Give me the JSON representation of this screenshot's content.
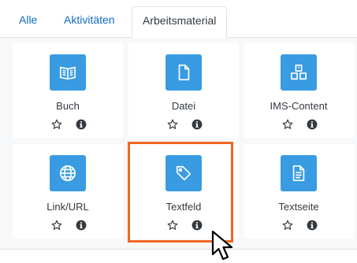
{
  "tabs": [
    {
      "label": "Alle",
      "active": false
    },
    {
      "label": "Aktivitäten",
      "active": false
    },
    {
      "label": "Arbeitsmaterial",
      "active": true
    }
  ],
  "tiles": [
    {
      "label": "Buch",
      "icon": "book-icon"
    },
    {
      "label": "Datei",
      "icon": "file-icon"
    },
    {
      "label": "IMS-Content",
      "icon": "ims-content-icon"
    },
    {
      "label": "Link/URL",
      "icon": "globe-icon"
    },
    {
      "label": "Textfeld",
      "icon": "tag-icon"
    },
    {
      "label": "Textseite",
      "icon": "page-icon"
    }
  ],
  "colors": {
    "accent": "#0f6cbf",
    "icon_background": "#399be2",
    "highlight": "#f26722"
  }
}
